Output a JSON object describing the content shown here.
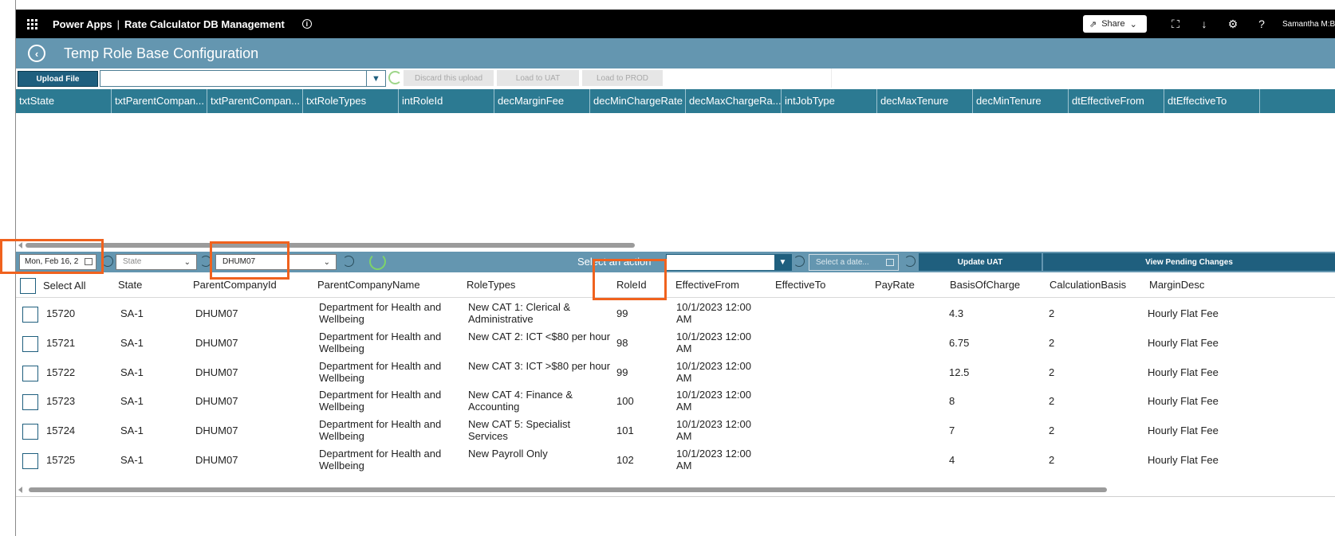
{
  "topbar": {
    "app_name": "Power Apps",
    "separator": "|",
    "app_title": "Rate Calculator DB Management",
    "share_label": "Share",
    "user_name": "Samantha M:B"
  },
  "titlebar": {
    "title": "Temp Role Base Configuration"
  },
  "upload": {
    "upload_label": "Upload File",
    "file_value": "",
    "discard_label": "Discard this upload",
    "load_uat_label": "Load to UAT",
    "load_prod_label": "Load to PROD"
  },
  "upload_grid": {
    "columns": [
      "txtState",
      "txtParentCompan...",
      "txtParentCompan...",
      "txtRoleTypes",
      "intRoleId",
      "decMarginFee",
      "decMinChargeRate",
      "decMaxChargeRa...",
      "intJobType",
      "decMaxTenure",
      "decMinTenure",
      "dtEffectiveFrom",
      "dtEffectiveTo"
    ]
  },
  "filters": {
    "date_value": "Mon, Feb 16, 2",
    "state_placeholder": "State",
    "company_value": "DHUM07",
    "action_label": "Select an action",
    "action_value": "",
    "date2_placeholder": "Select a date...",
    "update_uat_label": "Update UAT",
    "view_pending_label": "View Pending Changes"
  },
  "gallery": {
    "select_all_label": "Select All",
    "headers": {
      "state": "State",
      "parent_company_id": "ParentCompanyId",
      "parent_company_name": "ParentCompanyName",
      "role_types": "RoleTypes",
      "role_id": "RoleId",
      "effective_from": "EffectiveFrom",
      "effective_to": "EffectiveTo",
      "pay_rate": "PayRate",
      "basis_of_charge": "BasisOfCharge",
      "calculation_basis": "CalculationBasis",
      "margin_desc": "MarginDesc"
    },
    "rows": [
      {
        "id": "15720",
        "state": "SA-1",
        "company_id": "DHUM07",
        "company_name": "Department for Health and Wellbeing",
        "role_type": "New CAT 1: Clerical & Administrative",
        "role_id": "99",
        "effective_from": "10/1/2023 12:00 AM",
        "effective_to": "",
        "pay_rate": "",
        "basis": "4.3",
        "calc": "2",
        "margin": "Hourly Flat Fee"
      },
      {
        "id": "15721",
        "state": "SA-1",
        "company_id": "DHUM07",
        "company_name": "Department for Health and Wellbeing",
        "role_type": "New CAT 2: ICT <$80 per hour",
        "role_id": "98",
        "effective_from": "10/1/2023 12:00 AM",
        "effective_to": "",
        "pay_rate": "",
        "basis": "6.75",
        "calc": "2",
        "margin": "Hourly Flat Fee"
      },
      {
        "id": "15722",
        "state": "SA-1",
        "company_id": "DHUM07",
        "company_name": "Department for Health and Wellbeing",
        "role_type": "New CAT 3: ICT >$80 per hour",
        "role_id": "99",
        "effective_from": "10/1/2023 12:00 AM",
        "effective_to": "",
        "pay_rate": "",
        "basis": "12.5",
        "calc": "2",
        "margin": "Hourly Flat Fee"
      },
      {
        "id": "15723",
        "state": "SA-1",
        "company_id": "DHUM07",
        "company_name": "Department for Health and Wellbeing",
        "role_type": "New CAT 4: Finance & Accounting",
        "role_id": "100",
        "effective_from": "10/1/2023 12:00 AM",
        "effective_to": "",
        "pay_rate": "",
        "basis": "8",
        "calc": "2",
        "margin": "Hourly Flat Fee"
      },
      {
        "id": "15724",
        "state": "SA-1",
        "company_id": "DHUM07",
        "company_name": "Department for Health and Wellbeing",
        "role_type": "New CAT 5: Specialist Services",
        "role_id": "101",
        "effective_from": "10/1/2023 12:00 AM",
        "effective_to": "",
        "pay_rate": "",
        "basis": "7",
        "calc": "2",
        "margin": "Hourly Flat Fee"
      },
      {
        "id": "15725",
        "state": "SA-1",
        "company_id": "DHUM07",
        "company_name": "Department for Health and Wellbeing",
        "role_type": "New Payroll Only",
        "role_id": "102",
        "effective_from": "10/1/2023 12:00 AM",
        "effective_to": "",
        "pay_rate": "",
        "basis": "4",
        "calc": "2",
        "margin": "Hourly Flat Fee"
      }
    ]
  },
  "colors": {
    "topbar": "#000000",
    "header": "#6496b0",
    "grid_header": "#2c7a92",
    "button": "#1f5f7e",
    "highlight": "#f0621e"
  }
}
